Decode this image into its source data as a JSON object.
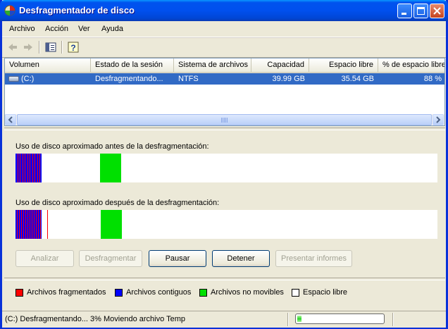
{
  "window": {
    "title": "Desfragmentador de disco"
  },
  "menu": {
    "items": [
      "Archivo",
      "Acción",
      "Ver",
      "Ayuda"
    ]
  },
  "list": {
    "columns": [
      "Volumen",
      "Estado de la sesión",
      "Sistema de archivos",
      "Capacidad",
      "Espacio libre",
      "% de espacio libre"
    ],
    "rows": [
      {
        "volume": "(C:)",
        "status": "Desfragmentando...",
        "fs": "NTFS",
        "capacity": "39.99 GB",
        "free": "35.54 GB",
        "pct": "88 %"
      }
    ]
  },
  "analysis": {
    "before_label": "Uso de disco aproximado antes de la desfragmentación:",
    "after_label": "Uso de disco aproximado después de la desfragmentación:"
  },
  "buttons": {
    "analyze": "Analizar",
    "defrag": "Desfragmentar",
    "pause": "Pausar",
    "stop": "Detener",
    "report": "Presentar informes"
  },
  "legend": {
    "fragmented": "Archivos fragmentados",
    "contiguous": "Archivos contiguos",
    "unmovable": "Archivos no movibles",
    "free": "Espacio libre"
  },
  "colors": {
    "fragmented": "#ff0000",
    "contiguous": "#0000ff",
    "unmovable": "#00e000",
    "free": "#ffffff"
  },
  "status": {
    "text": "(C:) Desfragmentando...  3%  Moviendo archivo Temp",
    "progress_percent": 3
  }
}
